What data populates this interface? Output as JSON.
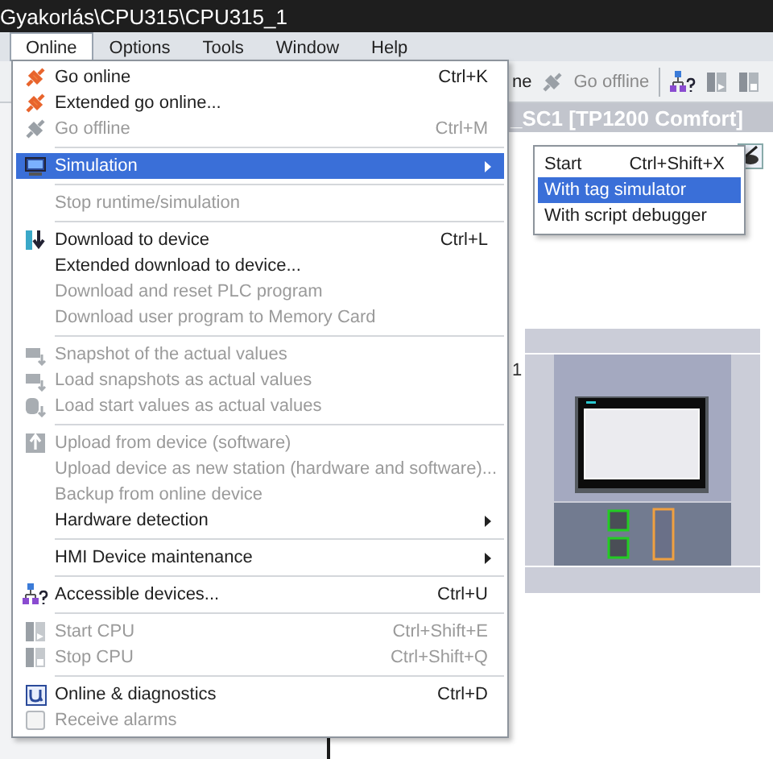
{
  "window": {
    "title": "Gyakorlás\\CPU315\\CPU315_1"
  },
  "menubar": [
    {
      "label": "Online",
      "selected": true
    },
    {
      "label": "Options",
      "selected": false
    },
    {
      "label": "Tools",
      "selected": false
    },
    {
      "label": "Window",
      "selected": false
    },
    {
      "label": "Help",
      "selected": false
    }
  ],
  "toolbar": {
    "items": [
      {
        "label": "ne",
        "disabled": false
      },
      {
        "label": "Go offline",
        "disabled": true
      }
    ]
  },
  "editor": {
    "title": "_SC1 [TP1200 Comfort]",
    "device_label": "1"
  },
  "menu": [
    {
      "kind": "item",
      "label": "Go online",
      "shortcut": "Ctrl+K",
      "disabled": false,
      "selected": false,
      "submenu": false
    },
    {
      "kind": "item",
      "label": "Extended go online...",
      "disabled": false,
      "selected": false,
      "submenu": false
    },
    {
      "kind": "item",
      "label": "Go offline",
      "shortcut": "Ctrl+M",
      "disabled": true,
      "selected": false,
      "submenu": false
    },
    {
      "kind": "separator"
    },
    {
      "kind": "item",
      "label": "Simulation",
      "disabled": false,
      "selected": true,
      "submenu": true
    },
    {
      "kind": "separator"
    },
    {
      "kind": "item",
      "label": "Stop runtime/simulation",
      "disabled": true,
      "selected": false,
      "submenu": false
    },
    {
      "kind": "separator"
    },
    {
      "kind": "item",
      "label": "Download to device",
      "shortcut": "Ctrl+L",
      "disabled": false,
      "selected": false,
      "submenu": false
    },
    {
      "kind": "item",
      "label": "Extended download to device...",
      "disabled": false,
      "selected": false,
      "submenu": false
    },
    {
      "kind": "item",
      "label": "Download and reset PLC program",
      "disabled": true,
      "selected": false,
      "submenu": false
    },
    {
      "kind": "item",
      "label": "Download user program to Memory Card",
      "disabled": true,
      "selected": false,
      "submenu": false
    },
    {
      "kind": "separator"
    },
    {
      "kind": "item",
      "label": "Snapshot of the actual values",
      "disabled": true,
      "selected": false,
      "submenu": false
    },
    {
      "kind": "item",
      "label": "Load snapshots as actual values",
      "disabled": true,
      "selected": false,
      "submenu": false
    },
    {
      "kind": "item",
      "label": "Load start values as actual values",
      "disabled": true,
      "selected": false,
      "submenu": false
    },
    {
      "kind": "separator"
    },
    {
      "kind": "item",
      "label": "Upload from device (software)",
      "disabled": true,
      "selected": false,
      "submenu": false
    },
    {
      "kind": "item",
      "label": "Upload device as new station (hardware and software)...",
      "disabled": true,
      "selected": false,
      "submenu": false
    },
    {
      "kind": "item",
      "label": "Backup from online device",
      "disabled": true,
      "selected": false,
      "submenu": false
    },
    {
      "kind": "item",
      "label": "Hardware detection",
      "disabled": false,
      "selected": false,
      "submenu": true
    },
    {
      "kind": "separator"
    },
    {
      "kind": "item",
      "label": "HMI Device maintenance",
      "disabled": false,
      "selected": false,
      "submenu": true
    },
    {
      "kind": "separator"
    },
    {
      "kind": "item",
      "label": "Accessible devices...",
      "shortcut": "Ctrl+U",
      "disabled": false,
      "selected": false,
      "submenu": false
    },
    {
      "kind": "separator"
    },
    {
      "kind": "item",
      "label": "Start CPU",
      "shortcut": "Ctrl+Shift+E",
      "disabled": true,
      "selected": false,
      "submenu": false
    },
    {
      "kind": "item",
      "label": "Stop CPU",
      "shortcut": "Ctrl+Shift+Q",
      "disabled": true,
      "selected": false,
      "submenu": false
    },
    {
      "kind": "separator"
    },
    {
      "kind": "item",
      "label": "Online & diagnostics",
      "shortcut": "Ctrl+D",
      "disabled": false,
      "selected": false,
      "submenu": false
    },
    {
      "kind": "check",
      "label": "Receive alarms",
      "checked": false,
      "disabled": true,
      "selected": false,
      "submenu": false
    }
  ],
  "submenu": [
    {
      "label": "Start",
      "shortcut": "Ctrl+Shift+X",
      "selected": false
    },
    {
      "label": "With tag simulator",
      "selected": true
    },
    {
      "label": "With script debugger",
      "selected": false
    }
  ]
}
